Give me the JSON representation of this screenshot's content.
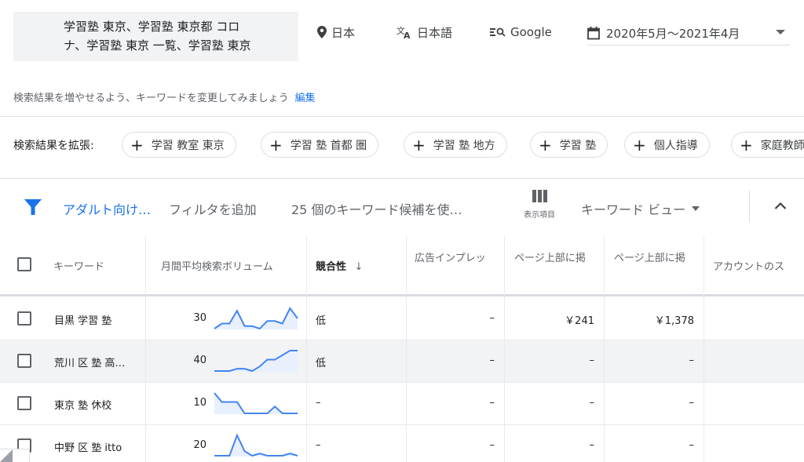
{
  "query": {
    "text_line1": "学習塾 東京、学習塾 東京都 コロ",
    "text_line2": "ナ、学習塾 東京 一覧、学習塾 東京"
  },
  "location": {
    "icon": "location-pin-icon",
    "label": "日本"
  },
  "language": {
    "icon": "translate-icon",
    "label": "日本語"
  },
  "network": {
    "icon": "search-network-icon",
    "label": "Google"
  },
  "date_range": {
    "icon": "calendar-icon",
    "label": "2020年5月〜2021年4月"
  },
  "hint": {
    "text": "検索結果を増やせるよう、キーワードを変更してみましょう",
    "edit_link": "編集"
  },
  "expand": {
    "label": "検索結果を拡張:",
    "chips": [
      "学習 教室 東京",
      "学習 塾 首都 圏",
      "学習 塾 地方",
      "学習 塾",
      "個人指導",
      "家庭教師"
    ]
  },
  "filters": {
    "adult_filter": "アダルト向け…",
    "add_filter": "フィルタを追加",
    "count_text": "25 個のキーワード候補を使…",
    "columns_label": "表示項目",
    "keyword_view": "キーワード ビュー"
  },
  "table": {
    "headers": {
      "keyword": "キーワード",
      "monthly_volume": "月間平均検索ボリューム",
      "competition": "競合性",
      "ad_impression_share": "広告インプレッ",
      "top_bid_low": "ページ上部に掲",
      "top_bid_high": "ページ上部に掲",
      "account_status": "アカウントのス"
    },
    "rows": [
      {
        "keyword": "目黒 学習 塾",
        "volume": "30",
        "trend": [
          2,
          4,
          4,
          9,
          3,
          3,
          2,
          5,
          5,
          4,
          10,
          6
        ],
        "competition": "低",
        "impression_share": "–",
        "bid_low": "￥241",
        "bid_high": "￥1,378"
      },
      {
        "keyword": "荒川 区 塾 高…",
        "volume": "40",
        "trend": [
          1,
          1,
          1,
          2,
          2,
          1,
          3,
          6,
          6,
          8,
          10,
          10
        ],
        "competition": "低",
        "impression_share": "–",
        "bid_low": "–",
        "bid_high": "–"
      },
      {
        "keyword": "東京 塾 休校",
        "volume": "10",
        "trend": [
          10,
          6,
          6,
          6,
          1,
          1,
          1,
          1,
          4,
          1,
          1,
          1
        ],
        "competition": "–",
        "impression_share": "–",
        "bid_low": "–",
        "bid_high": "–"
      },
      {
        "keyword": "中野 区 塾 itto",
        "volume": "20",
        "trend": [
          1,
          1,
          1,
          10,
          3,
          1,
          2,
          1,
          1,
          1,
          2,
          1
        ],
        "competition": "–",
        "impression_share": "–",
        "bid_low": "–",
        "bid_high": "–"
      }
    ]
  },
  "colors": {
    "accent": "#1a73e8",
    "spark_line": "#4285f4",
    "spark_fill": "#e8f0fe"
  }
}
